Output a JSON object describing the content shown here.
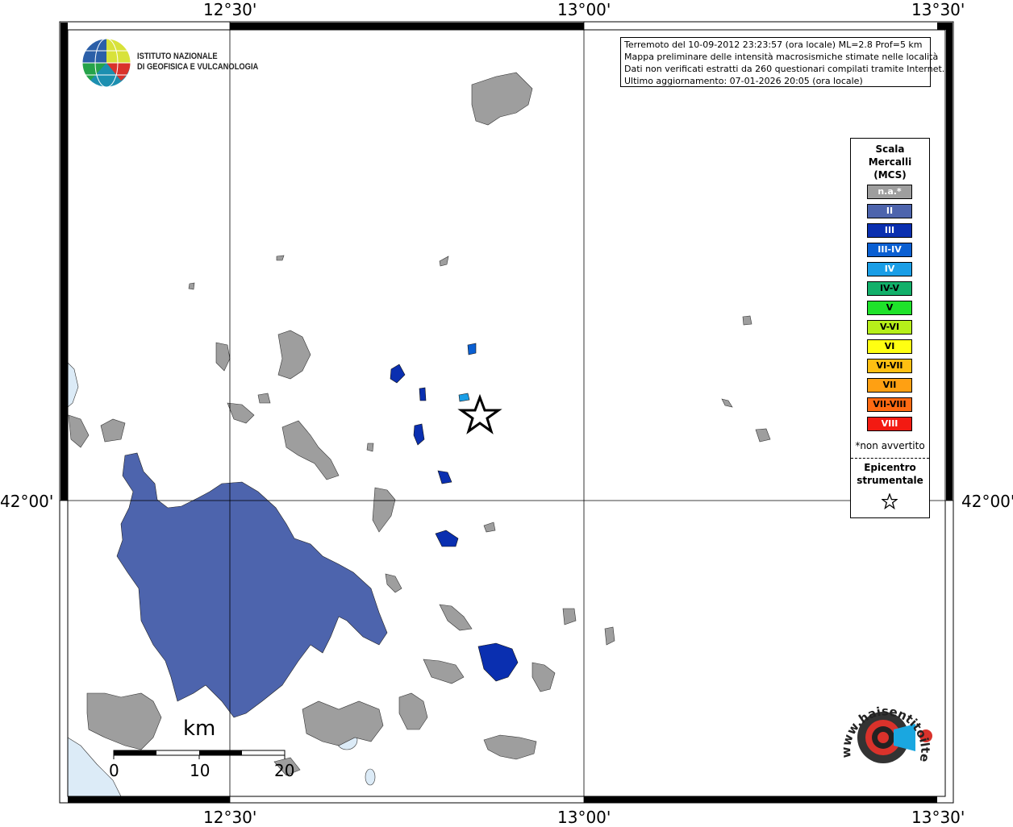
{
  "ticks": {
    "top": [
      "12°30'",
      "13°00'",
      "13°30'"
    ],
    "bottom": [
      "12°30'",
      "13°00'",
      "13°30'"
    ],
    "left": "42°00'",
    "right": "42°00'"
  },
  "institute": {
    "line1": "ISTITUTO NAZIONALE",
    "line2": "DI GEOFISICA E VULCANOLOGIA"
  },
  "info_box": {
    "line1": "Terremoto del 10-09-2012 23:23:57 (ora locale) ML=2.8 Prof=5 km",
    "line2": "Mappa preliminare delle intensità macrosismiche stimate nelle località",
    "line3": "Dati non verificati estratti da 260 questionari compilati tramite Internet.",
    "line4": "Ultimo aggiornamento: 07-01-2026 20:05 (ora locale)"
  },
  "legend": {
    "title": [
      "Scala",
      "Mercalli",
      "(MCS)"
    ],
    "items": [
      {
        "label": "n.a.*",
        "color": "#9e9e9e",
        "text_color": "#ffffff"
      },
      {
        "label": "II",
        "color": "#4d64ad",
        "text_color": "#ffffff"
      },
      {
        "label": "III",
        "color": "#0a2fb0",
        "text_color": "#ffffff"
      },
      {
        "label": "III-IV",
        "color": "#0a5fd2",
        "text_color": "#ffffff"
      },
      {
        "label": "IV",
        "color": "#1a9ee6",
        "text_color": "#ffffff"
      },
      {
        "label": "IV-V",
        "color": "#12b06a",
        "text_color": "#000000"
      },
      {
        "label": "V",
        "color": "#1fe22a",
        "text_color": "#000000"
      },
      {
        "label": "V-VI",
        "color": "#b6ef1a",
        "text_color": "#000000"
      },
      {
        "label": "VI",
        "color": "#ffff12",
        "text_color": "#000000"
      },
      {
        "label": "VI-VII",
        "color": "#ffbf12",
        "text_color": "#000000"
      },
      {
        "label": "VII",
        "color": "#ffa012",
        "text_color": "#000000"
      },
      {
        "label": "VII-VIII",
        "color": "#ff6a12",
        "text_color": "#000000"
      },
      {
        "label": "VIII",
        "color": "#f31a12",
        "text_color": "#ffffff"
      }
    ],
    "note": "*non avvertito",
    "epicenter_title": [
      "Epicentro",
      "strumentale"
    ]
  },
  "scale_bar": {
    "unit": "km",
    "labels": [
      "0",
      "10",
      "20"
    ]
  },
  "watermark": {
    "text": "www.haisentitoilterremoto.it"
  },
  "colors": {
    "na_gray": "#9e9e9e",
    "ii": "#4d64ad",
    "iii": "#0a2fb0",
    "iii_iv": "#0a5fd2",
    "iv": "#1a9ee6",
    "sea": "#dcebf7"
  }
}
